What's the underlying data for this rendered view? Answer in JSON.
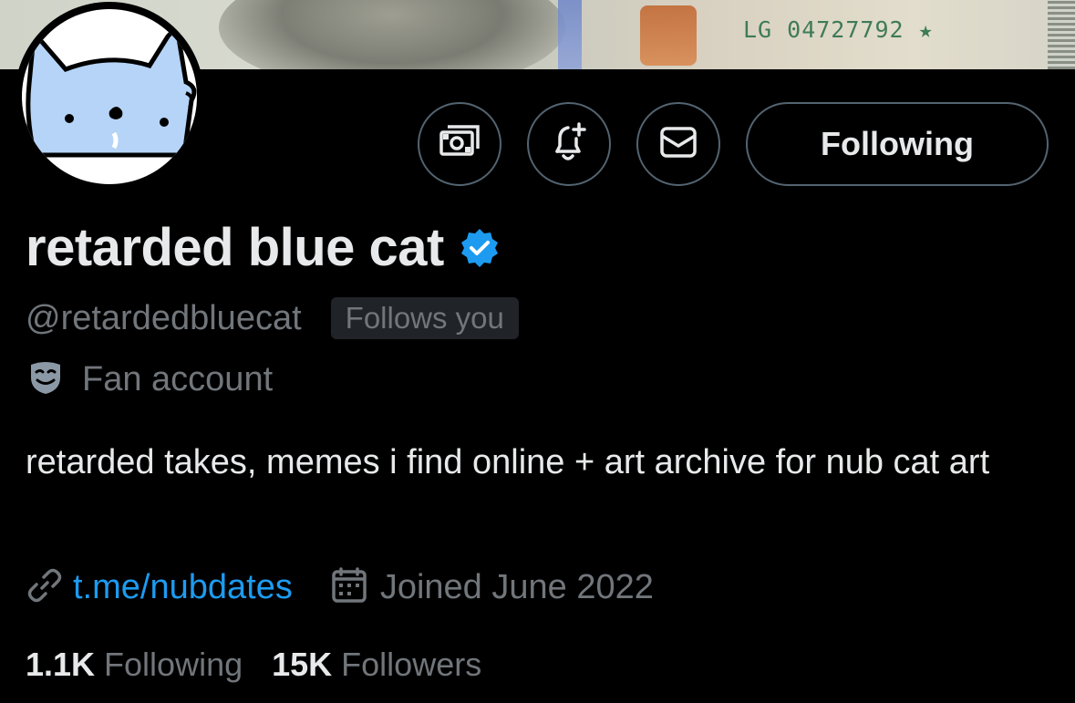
{
  "banner": {
    "serial": "LG 04727792 ★"
  },
  "profile": {
    "name": "retarded blue cat",
    "verified_icon": "verified-badge-icon",
    "handle": "@retardedbluecat",
    "follows_you": "Follows you",
    "category": "Fan account",
    "category_icon": "theater-mask-icon",
    "bio": "retarded takes, memes i find online + art archive for nub cat art",
    "link": "t.me/nubdates",
    "link_icon": "link-icon",
    "joined": "Joined June 2022",
    "joined_icon": "calendar-icon"
  },
  "actions": {
    "tip_icon": "money-icon",
    "notify_icon": "bell-plus-icon",
    "message_icon": "envelope-icon",
    "follow_label": "Following"
  },
  "stats": {
    "following_count": "1.1K",
    "following_label": "Following",
    "followers_count": "15K",
    "followers_label": "Followers"
  },
  "colors": {
    "accent": "#1d9bf0",
    "muted": "#71767b",
    "avatar_cat": "#b5d4f7"
  }
}
